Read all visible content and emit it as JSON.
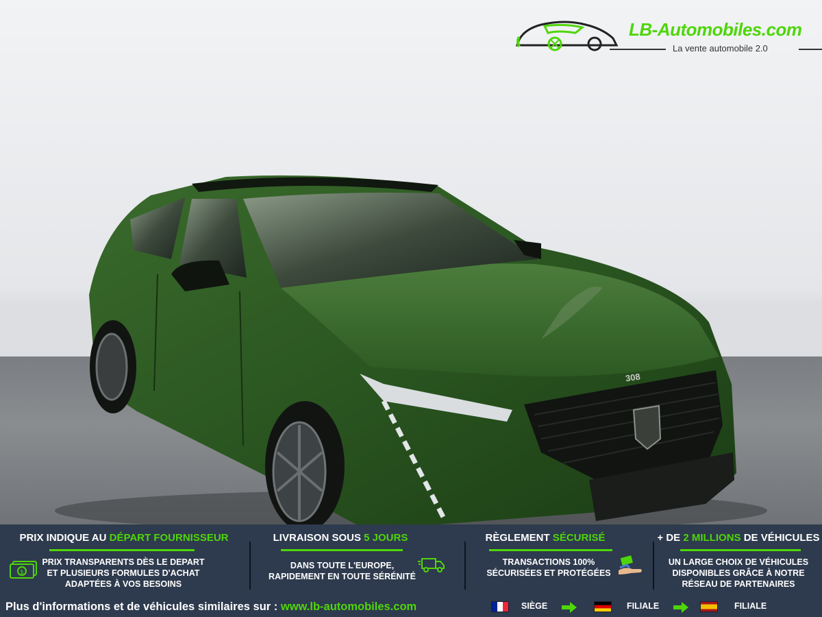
{
  "logo": {
    "name": "LB-Automobiles.com",
    "tagline": "La vente automobile 2.0",
    "accent": "#4fd60a"
  },
  "photo": {
    "car_badge": "308",
    "car_color": "#2c5a22"
  },
  "banner": {
    "background": "#2e3a4d",
    "columns": [
      {
        "title_prefix": "PRIX INDIQUE AU ",
        "title_highlight": "DÉPART FOURNISSEUR",
        "title_suffix": "",
        "lines": [
          "PRIX TRANSPARENTS DÈS LE DEPART",
          "ET PLUSIEURS FORMULES D'ACHAT",
          "ADAPTÉES À VOS BESOINS"
        ],
        "icon": "cash-icon"
      },
      {
        "title_prefix": "LIVRAISON SOUS ",
        "title_highlight": "5 JOURS",
        "title_suffix": "",
        "lines": [
          "DANS TOUTE L'EUROPE,",
          "RAPIDEMENT EN TOUTE SÉRÉNITÉ"
        ],
        "icon": "delivery-truck-icon"
      },
      {
        "title_prefix": "RÈGLEMENT ",
        "title_highlight": "SÉCURISÉ",
        "title_suffix": "",
        "lines": [
          "TRANSACTIONS 100%",
          "SÉCURISÉES ET PROTÉGÉES"
        ],
        "icon": "payment-hand-icon"
      },
      {
        "title_prefix": "+ DE ",
        "title_highlight": "2 MILLIONS",
        "title_suffix": " DE VÉHICULES",
        "lines": [
          "UN LARGE CHOIX DE VÉHICULES",
          "DISPONIBLES GRÂCE À NOTRE",
          "RÉSEAU DE PARTENAIRES"
        ],
        "icon": ""
      }
    ]
  },
  "footer": {
    "text": "Plus d'informations et de véhicules similaires sur : ",
    "url": "www.lb-automobiles.com",
    "locations": [
      {
        "flag": "france-flag-icon",
        "label": "SIÈGE"
      },
      {
        "flag": "germany-flag-icon",
        "label": "FILIALE"
      },
      {
        "flag": "spain-flag-icon",
        "label": "FILIALE"
      }
    ]
  }
}
